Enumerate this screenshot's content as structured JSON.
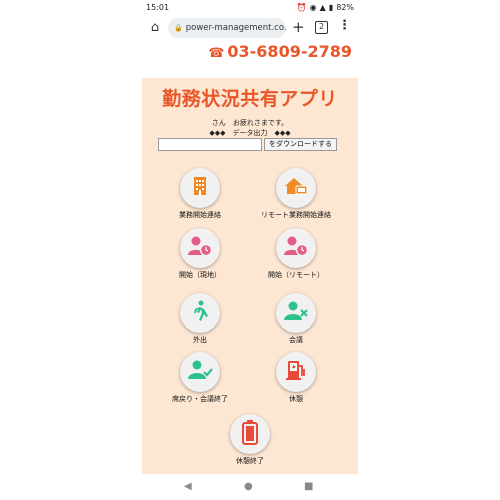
{
  "status_bar": {
    "time": "15:01",
    "battery": "82%"
  },
  "browser": {
    "url": "power-management.co.jp",
    "tab_count": "2"
  },
  "header": {
    "phone": "03-6809-2789"
  },
  "app": {
    "title": "勤務状況共有アプリ",
    "greeting": "さん　お疲れさまです。",
    "data_export": "◆◆◆　データ出力　◆◆◆",
    "download_button": "をダウンロードする"
  },
  "tiles": [
    {
      "label": "業務開始連絡",
      "icon": "office-building-icon",
      "color": "#f08a24"
    },
    {
      "label": "リモート業務開始連絡",
      "icon": "remote-home-icon",
      "color": "#f08a24"
    },
    {
      "label": "開始（現地）",
      "icon": "user-clock-icon",
      "color": "#e35d86"
    },
    {
      "label": "開始（リモート）",
      "icon": "user-clock-icon",
      "color": "#e35d86"
    },
    {
      "label": "外出",
      "icon": "walking-person-icon",
      "color": "#2fc18c"
    },
    {
      "label": "会議",
      "icon": "user-x-icon",
      "color": "#2fc18c"
    },
    {
      "label": "席戻り・会議終了",
      "icon": "user-check-icon",
      "color": "#2fc18c"
    },
    {
      "label": "休憩",
      "icon": "charging-station-icon",
      "color": "#e84a3a"
    },
    {
      "label": "休憩終了",
      "icon": "battery-icon",
      "color": "#e84a3a"
    }
  ],
  "nav": {
    "back": "◀",
    "home": "●",
    "recents": "■"
  }
}
